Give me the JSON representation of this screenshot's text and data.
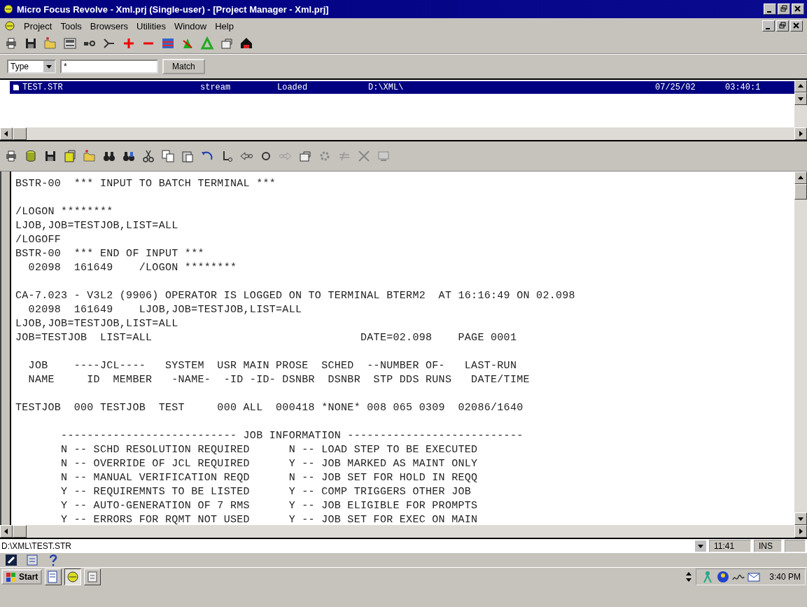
{
  "window": {
    "title": "Micro Focus Revolve - Xml.prj (Single-user) - [Project Manager - Xml.prj]"
  },
  "menu": [
    "Project",
    "Tools",
    "Browsers",
    "Utilities",
    "Window",
    "Help"
  ],
  "filter": {
    "type_value": "Type",
    "pattern_value": "*",
    "match_button": "Match"
  },
  "project_list": {
    "rows": [
      {
        "name": "TEST.STR",
        "type": "stream",
        "status": "Loaded",
        "path": "D:\\XML\\",
        "date": "07/25/02",
        "time": "03:40:1",
        "selected": true
      }
    ]
  },
  "editor": {
    "blocks": [
      {
        "lines": [
          "BSTR-00  *** INPUT TO BATCH TERMINAL ***"
        ]
      },
      {
        "lines": [
          "/LOGON ********",
          "LJOB,JOB=TESTJOB,LIST=ALL",
          "/LOGOFF",
          "BSTR-00  *** END OF INPUT ***",
          "  02098  161649    /LOGON ********"
        ]
      },
      {
        "lines": [
          "CA-7.023 - V3L2 (9906) OPERATOR IS LOGGED ON TO TERMINAL BTERM2  AT 16:16:49 ON 02.098",
          "  02098  161649    LJOB,JOB=TESTJOB,LIST=ALL",
          "LJOB,JOB=TESTJOB,LIST=ALL",
          "JOB=TESTJOB  LIST=ALL                                DATE=02.098    PAGE 0001"
        ]
      },
      {
        "lines": [
          "  JOB    ----JCL----   SYSTEM  USR MAIN PROSE  SCHED  --NUMBER OF-   LAST-RUN",
          "  NAME     ID  MEMBER   -NAME-  -ID -ID- DSNBR  DSNBR  STP DDS RUNS   DATE/TIME"
        ]
      },
      {
        "lines": [
          "TESTJOB  000 TESTJOB  TEST     000 ALL  000418 *NONE* 008 065 0309  02086/1640"
        ]
      },
      {
        "lines": [
          "       --------------------------- JOB INFORMATION ---------------------------",
          "       N -- SCHD RESOLUTION REQUIRED      N -- LOAD STEP TO BE EXECUTED",
          "       N -- OVERRIDE OF JCL REQUIRED      Y -- JOB MARKED AS MAINT ONLY",
          "       N -- MANUAL VERIFICATION REQD      N -- JOB SET FOR HOLD IN REQQ",
          "       Y -- REQUIREMNTS TO BE LISTED      Y -- COMP TRIGGERS OTHER JOB",
          "       Y -- AUTO-GENERATION OF 7 RMS      Y -- JOB ELIGIBLE FOR PROMPTS",
          "       Y -- ERRORS FOR RQMT NOT USED      Y -- JOB SET FOR EXEC ON MAIN"
        ]
      }
    ]
  },
  "status_bar": {
    "path": "D:\\XML\\TEST.STR",
    "position": "11:41",
    "mode": "INS"
  },
  "taskbar": {
    "start": "Start",
    "clock": "3:40 PM"
  }
}
